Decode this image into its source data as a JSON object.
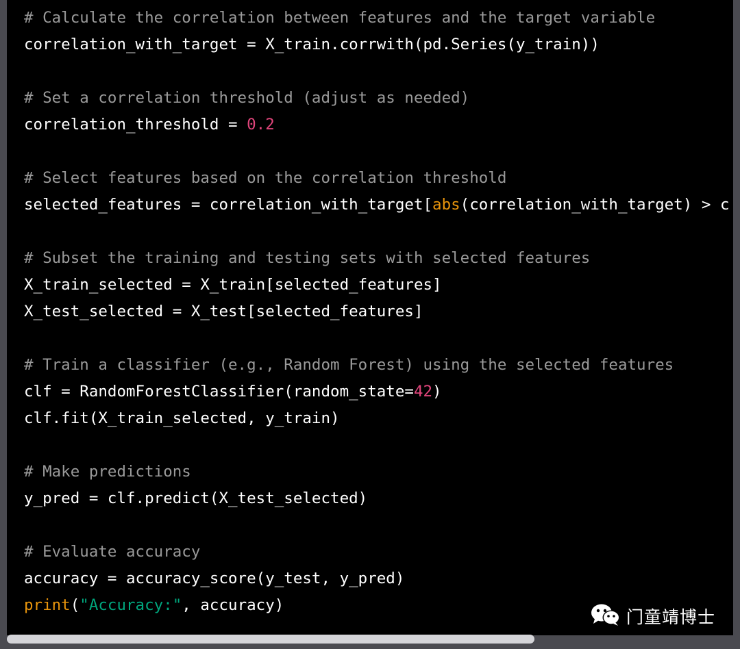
{
  "code_block": {
    "lines": [
      [
        {
          "t": "comment",
          "v": "# Calculate the correlation between features and the target variable"
        }
      ],
      [
        {
          "t": "plain",
          "v": "correlation_with_target = X_train.corrwith(pd.Series(y_train))"
        }
      ],
      [],
      [
        {
          "t": "comment",
          "v": "# Set a correlation threshold (adjust as needed)"
        }
      ],
      [
        {
          "t": "plain",
          "v": "correlation_threshold = "
        },
        {
          "t": "number",
          "v": "0.2"
        }
      ],
      [],
      [
        {
          "t": "comment",
          "v": "# Select features based on the correlation threshold"
        }
      ],
      [
        {
          "t": "plain",
          "v": "selected_features = correlation_with_target["
        },
        {
          "t": "builtin",
          "v": "abs"
        },
        {
          "t": "plain",
          "v": "(correlation_with_target) > c"
        }
      ],
      [],
      [
        {
          "t": "comment",
          "v": "# Subset the training and testing sets with selected features"
        }
      ],
      [
        {
          "t": "plain",
          "v": "X_train_selected = X_train[selected_features]"
        }
      ],
      [
        {
          "t": "plain",
          "v": "X_test_selected = X_test[selected_features]"
        }
      ],
      [],
      [
        {
          "t": "comment",
          "v": "# Train a classifier (e.g., Random Forest) using the selected features"
        }
      ],
      [
        {
          "t": "plain",
          "v": "clf = RandomForestClassifier(random_state="
        },
        {
          "t": "number",
          "v": "42"
        },
        {
          "t": "plain",
          "v": ")"
        }
      ],
      [
        {
          "t": "plain",
          "v": "clf.fit(X_train_selected, y_train)"
        }
      ],
      [],
      [
        {
          "t": "comment",
          "v": "# Make predictions"
        }
      ],
      [
        {
          "t": "plain",
          "v": "y_pred = clf.predict(X_test_selected)"
        }
      ],
      [],
      [
        {
          "t": "comment",
          "v": "# Evaluate accuracy"
        }
      ],
      [
        {
          "t": "plain",
          "v": "accuracy = accuracy_score(y_test, y_pred)"
        }
      ],
      [
        {
          "t": "builtin",
          "v": "print"
        },
        {
          "t": "plain",
          "v": "("
        },
        {
          "t": "string",
          "v": "\"Accuracy:\""
        },
        {
          "t": "plain",
          "v": ", accuracy)"
        }
      ]
    ]
  },
  "scrollbar": {
    "horizontal_position": 0
  },
  "watermark": {
    "icon": "wechat-icon",
    "text": "门童靖博士"
  },
  "colors": {
    "background": "#000000",
    "comment": "#9a9a9a",
    "number": "#e0457b",
    "builtin": "#e9950c",
    "string": "#00a67d",
    "text": "#ffffff"
  }
}
